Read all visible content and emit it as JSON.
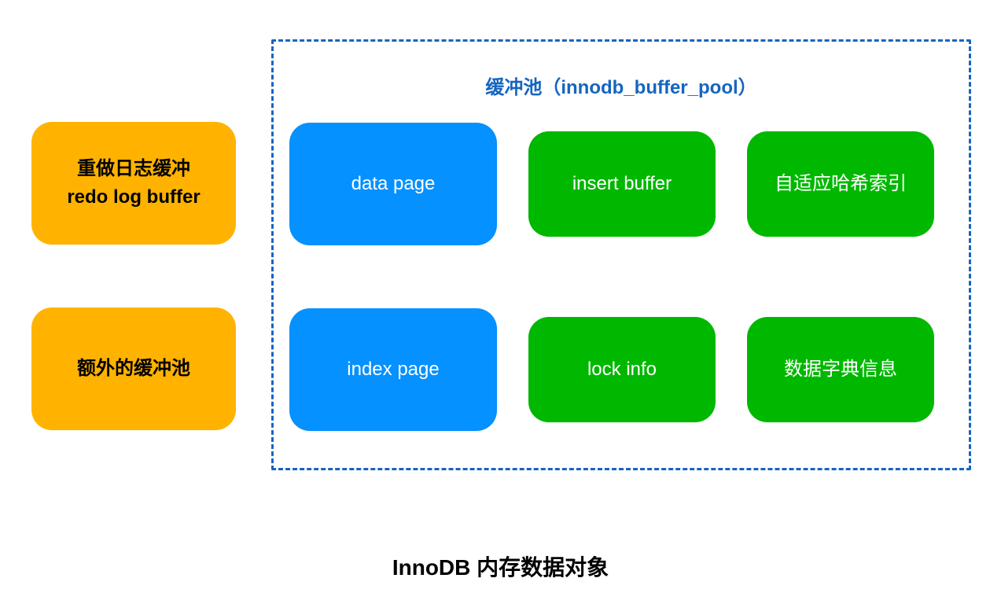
{
  "diagram": {
    "title": "InnoDB 内存数据对象",
    "bufferPool": {
      "title": "缓冲池（innodb_buffer_pool）",
      "items": {
        "dataPage": "data page",
        "insertBuffer": "insert buffer",
        "adaptiveHashIndex": "自适应哈希索引",
        "indexPage": "index page",
        "lockInfo": "lock info",
        "dataDictionary": "数据字典信息"
      }
    },
    "leftItems": {
      "redoLogBuffer": {
        "line1": "重做日志缓冲",
        "line2": "redo log buffer"
      },
      "extraBufferPool": "额外的缓冲池"
    }
  }
}
